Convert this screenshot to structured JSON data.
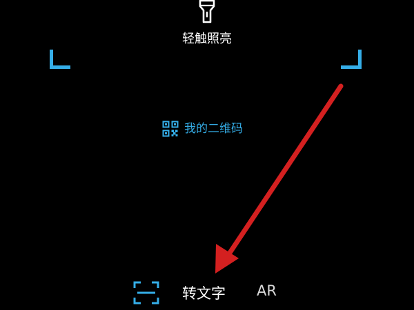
{
  "flashlight": {
    "label": "轻触照亮",
    "icon": "flashlight-icon"
  },
  "qr_code": {
    "label": "我的二维码",
    "icon": "qr-code-icon"
  },
  "bottom_tabs": {
    "scan_icon": "scan-icon",
    "text_label": "转文字",
    "ar_label": "AR"
  },
  "colors": {
    "accent": "#35aee8",
    "background": "#000000",
    "arrow": "#d42020"
  }
}
